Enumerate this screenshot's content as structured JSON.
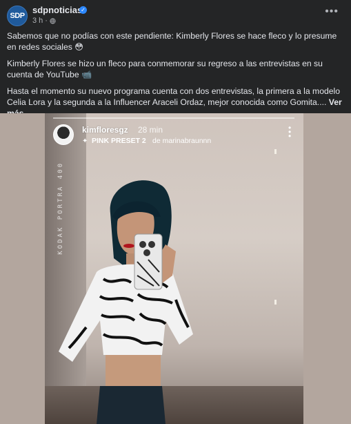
{
  "post": {
    "page_name": "sdpnoticias",
    "avatar_text": "SDP",
    "time": "3 h",
    "paragraphs": [
      "Sabemos que no podías con este pendiente: Kimberly Flores se hace fleco y lo presume en redes sociales 😳",
      "Kimberly Flores se  hizo un fleco para conmemorar su regreso a las entrevistas en su cuenta de YouTube 📹",
      "Hasta el momento su nuevo programa cuenta con dos entrevistas, la primera a la modelo Celia Lora y la segunda a la Influencer Araceli Ordaz, mejor conocida como Gomita.... "
    ],
    "see_more": "Ver más"
  },
  "story": {
    "username": "kimfloresgz",
    "time": "28 min",
    "preset": "PINK PRESET 2",
    "credit": "de marinabraunnn",
    "film_text": "KODAK PORTRA 400"
  },
  "colors": {
    "background": "#242526",
    "text": "#e4e6eb",
    "secondary_text": "#b0b3b8",
    "verified": "#2d88ff"
  }
}
